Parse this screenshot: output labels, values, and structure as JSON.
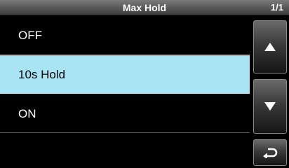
{
  "header": {
    "title": "Max Hold",
    "page_indicator": "1/1"
  },
  "list": {
    "items": [
      {
        "label": "OFF",
        "selected": false
      },
      {
        "label": "10s Hold",
        "selected": true
      },
      {
        "label": "ON",
        "selected": false
      }
    ]
  },
  "sidebar": {
    "up_icon": "triangle-up-icon",
    "down_icon": "triangle-down-icon",
    "back_icon": "return-arrow-icon"
  },
  "colors": {
    "selected_bg": "#a8e4f4",
    "background": "#000000",
    "text": "#ffffff"
  }
}
